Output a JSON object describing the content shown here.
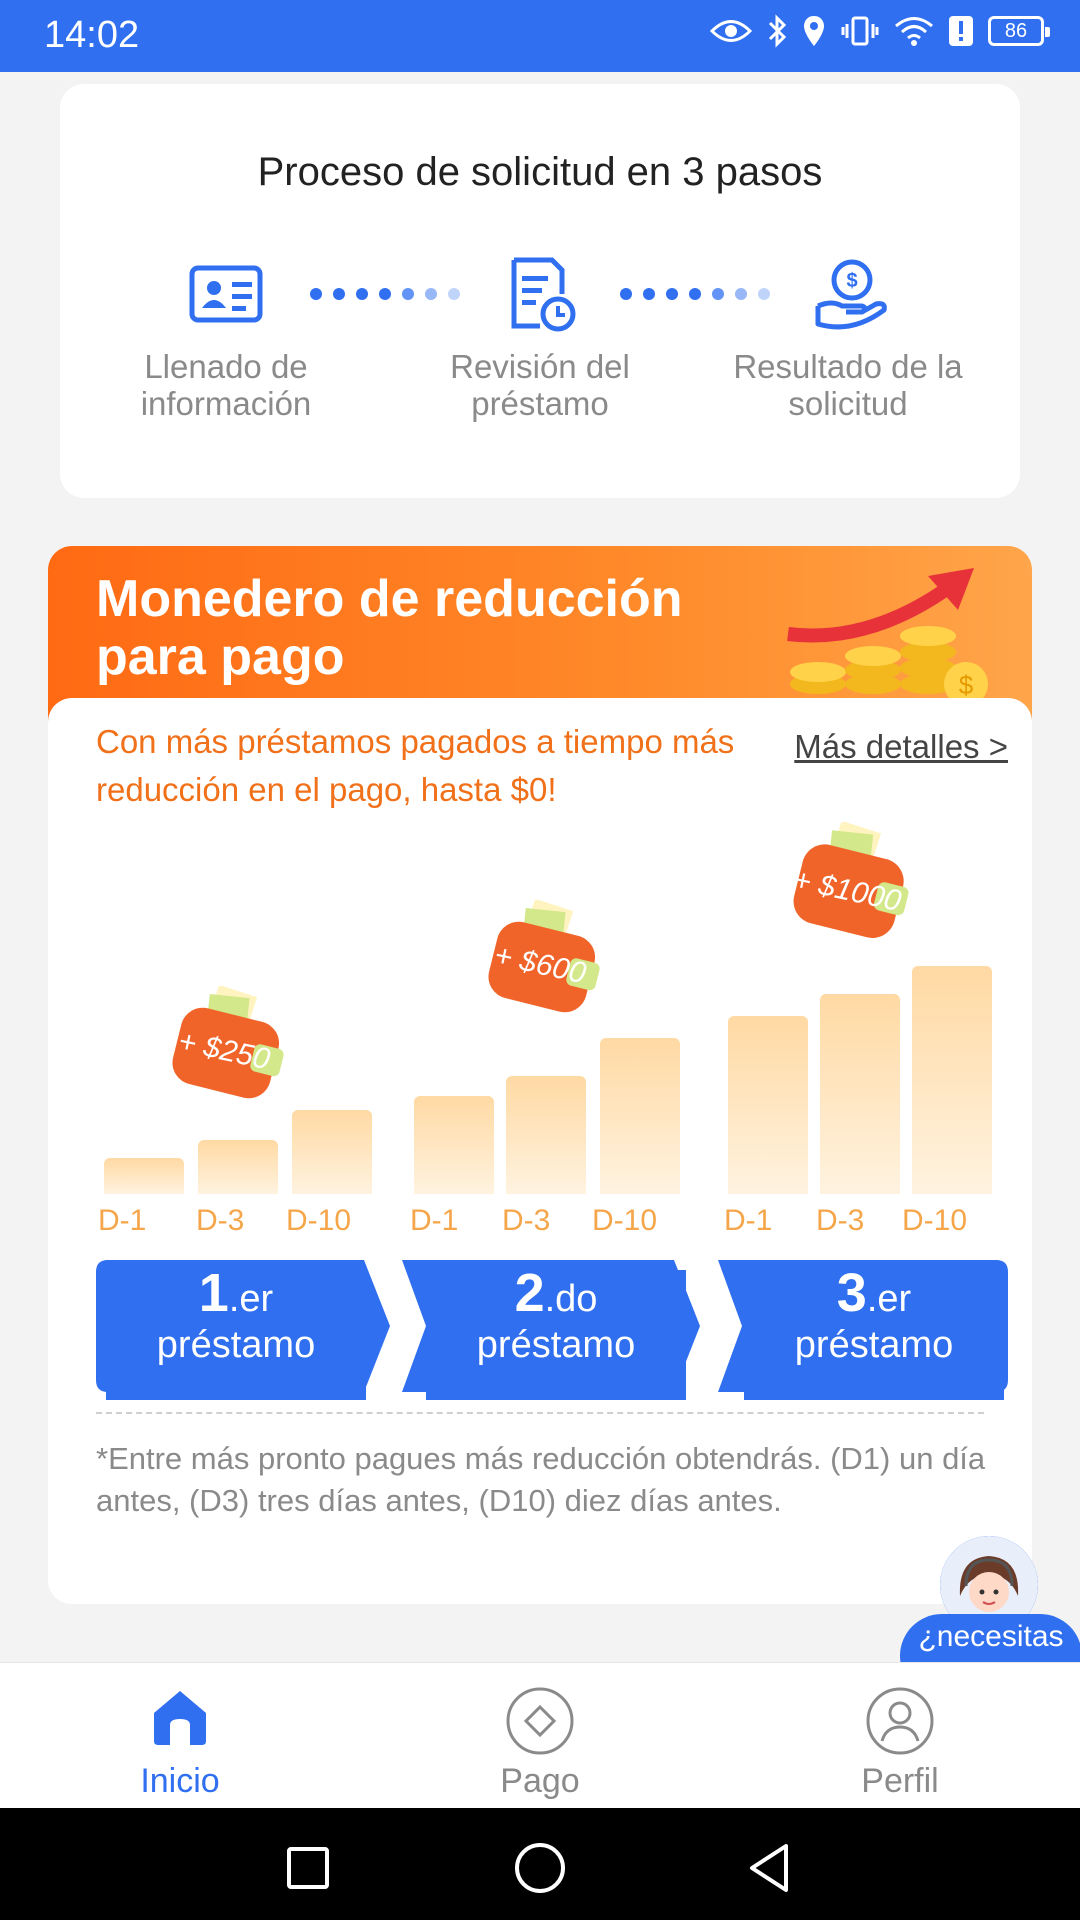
{
  "status_bar": {
    "time": "14:02",
    "battery": "86"
  },
  "steps": {
    "title": "Proceso de solicitud en 3 pasos",
    "items": [
      {
        "label": "Llenado de información",
        "icon": "id-card-icon"
      },
      {
        "label": "Revisión del préstamo",
        "icon": "document-clock-icon"
      },
      {
        "label": "Resultado de la solicitud",
        "icon": "hand-coin-icon"
      }
    ]
  },
  "promo": {
    "title": "Monedero de reducción para pago",
    "description": "Con más préstamos pagados a tiempo más reducción en el pago, hasta $0!",
    "more_link": "Más detalles >",
    "wallets": [
      "+ $250",
      "+ $600",
      "+ $1000"
    ],
    "bar_labels": [
      "D-1",
      "D-3",
      "D-10",
      "D-1",
      "D-3",
      "D-10",
      "D-1",
      "D-3",
      "D-10"
    ],
    "loans": [
      {
        "number": "1",
        "suffix": ".er",
        "label": "préstamo"
      },
      {
        "number": "2",
        "suffix": ".do",
        "label": "préstamo"
      },
      {
        "number": "3",
        "suffix": ".er",
        "label": "préstamo"
      }
    ],
    "footnote": "*Entre más pronto pagues más reducción obtendrás. (D1) un día antes, (D3) tres días antes, (D10) diez días antes."
  },
  "help": {
    "label": "¿necesitas ayuda?"
  },
  "nav": [
    {
      "label": "Inicio",
      "icon": "home-icon",
      "active": true
    },
    {
      "label": "Pago",
      "icon": "payment-icon",
      "active": false
    },
    {
      "label": "Perfil",
      "icon": "profile-icon",
      "active": false
    }
  ],
  "colors": {
    "primary": "#2f6ff0",
    "accent": "#f0711a"
  }
}
